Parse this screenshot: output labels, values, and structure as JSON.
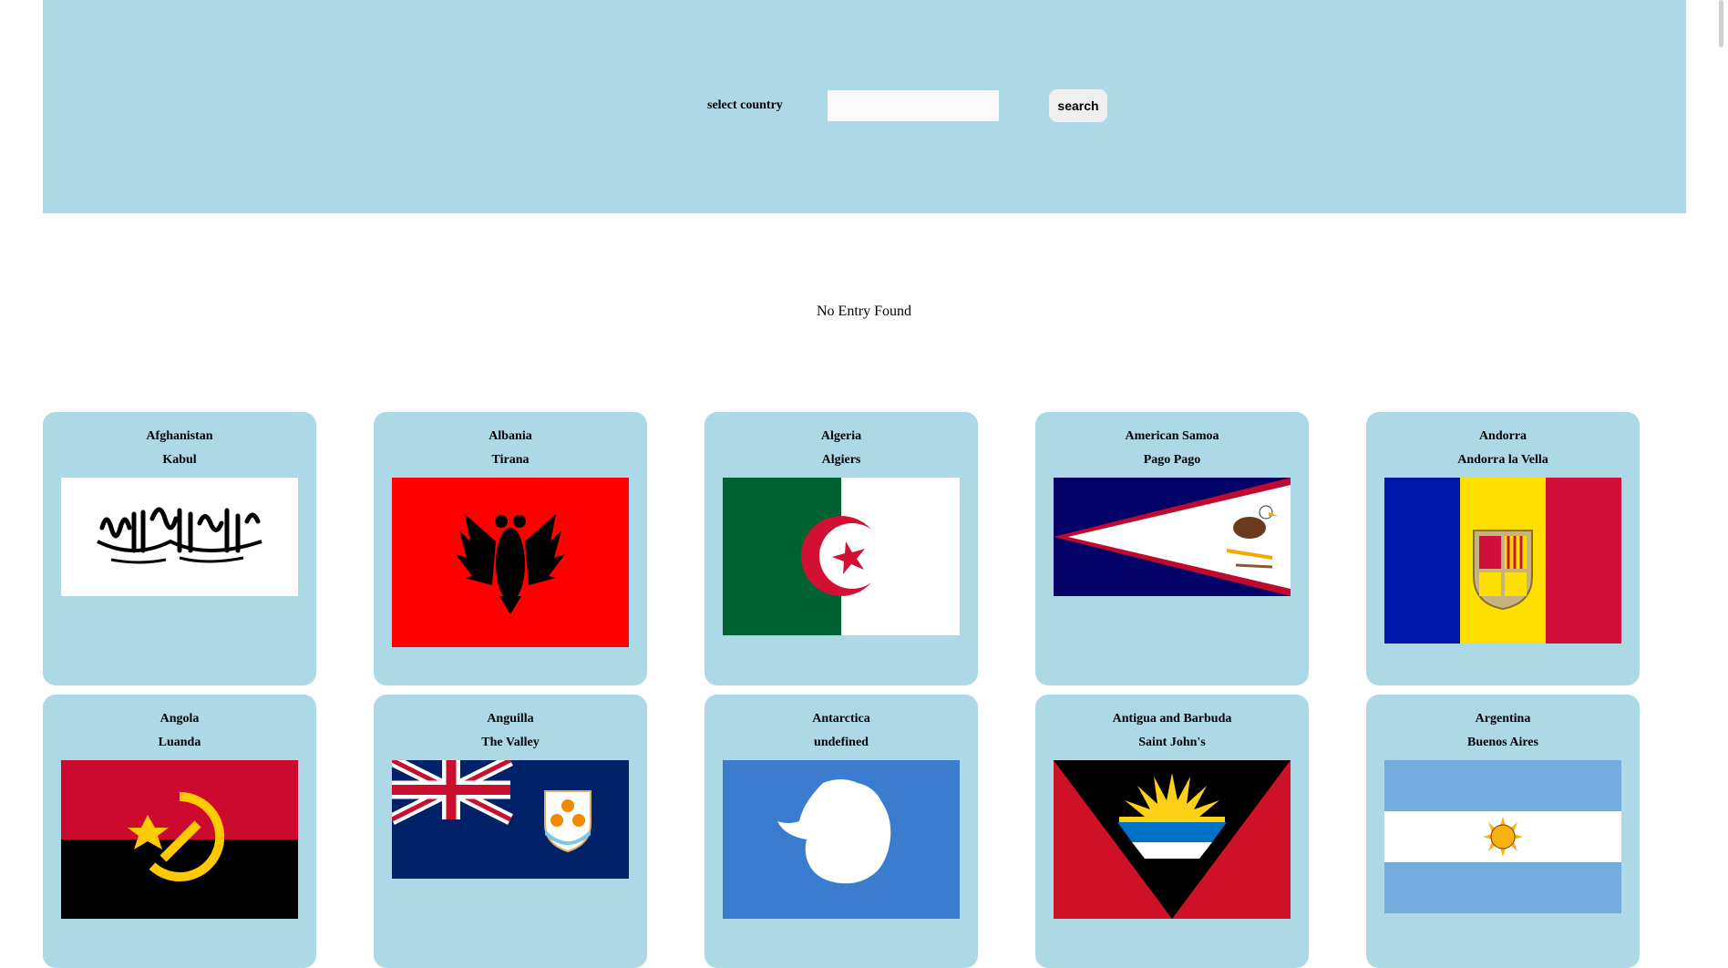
{
  "search": {
    "label": "select country",
    "input_value": "",
    "placeholder": "",
    "button_label": "search"
  },
  "status_text": "No Entry Found",
  "countries": [
    {
      "name": "Afghanistan",
      "capital": "Kabul",
      "flag_icon": "afghanistan-flag-icon"
    },
    {
      "name": "Albania",
      "capital": "Tirana",
      "flag_icon": "albania-flag-icon"
    },
    {
      "name": "Algeria",
      "capital": "Algiers",
      "flag_icon": "algeria-flag-icon"
    },
    {
      "name": "American Samoa",
      "capital": "Pago Pago",
      "flag_icon": "american-samoa-flag-icon"
    },
    {
      "name": "Andorra",
      "capital": "Andorra la Vella",
      "flag_icon": "andorra-flag-icon"
    },
    {
      "name": "Angola",
      "capital": "Luanda",
      "flag_icon": "angola-flag-icon"
    },
    {
      "name": "Anguilla",
      "capital": "The Valley",
      "flag_icon": "anguilla-flag-icon"
    },
    {
      "name": "Antarctica",
      "capital": "undefined",
      "flag_icon": "antarctica-flag-icon"
    },
    {
      "name": "Antigua and Barbuda",
      "capital": "Saint John's",
      "flag_icon": "antigua-and-barbuda-flag-icon"
    },
    {
      "name": "Argentina",
      "capital": "Buenos Aires",
      "flag_icon": "argentina-flag-icon"
    }
  ],
  "colors": {
    "header_bg": "#add8e6",
    "card_bg": "#add8e6"
  }
}
